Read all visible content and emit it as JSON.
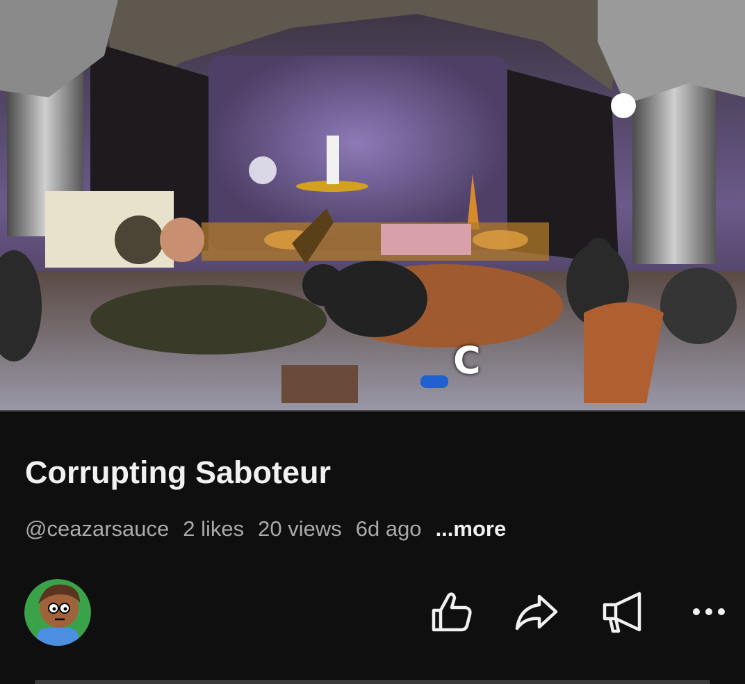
{
  "video": {
    "overlay_text": "C"
  },
  "short": {
    "title": "Corrupting Saboteur",
    "channel": "@ceazarsauce",
    "likes": "2 likes",
    "views": "20 views",
    "age": "6d ago",
    "more_label": "...more"
  },
  "actions": {
    "icons": [
      "like-icon",
      "share-icon",
      "report-icon",
      "more-icon"
    ]
  },
  "colors": {
    "background": "#0f0f0f",
    "title": "#f1f1f1",
    "meta": "#aaaaaa"
  }
}
